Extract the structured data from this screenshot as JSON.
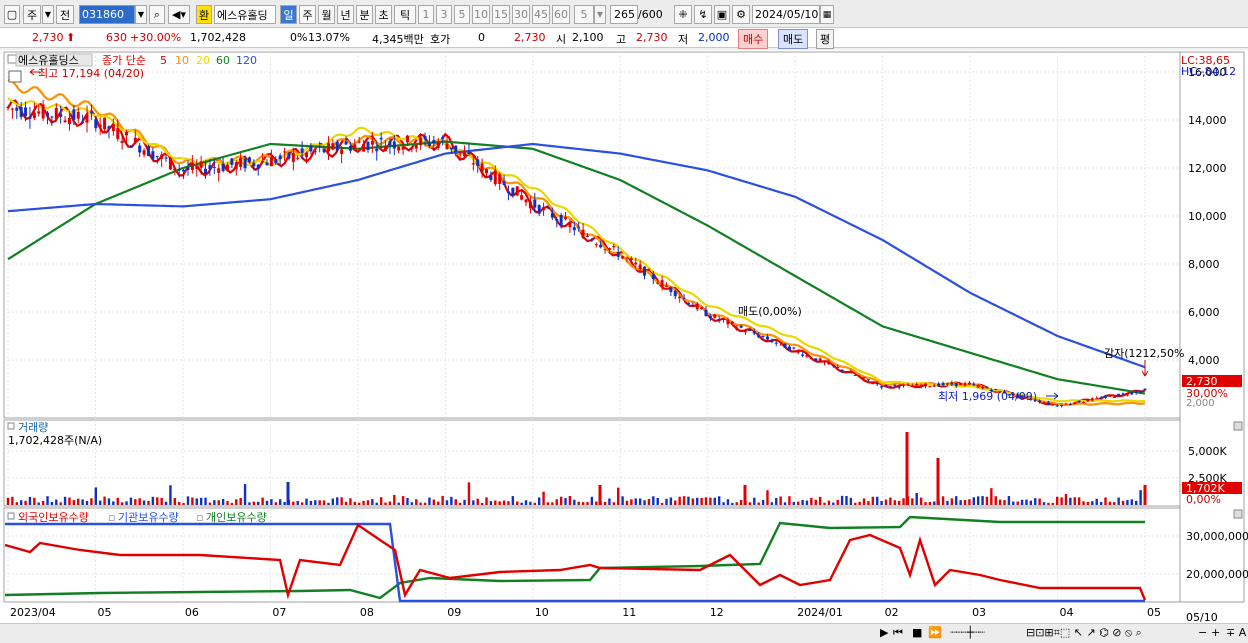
{
  "toolbar": {
    "market": "주",
    "prev": "전",
    "code": "031860",
    "exch_badge": "환",
    "name": "에스유홀딩",
    "periods": [
      "일",
      "주",
      "월",
      "년",
      "분",
      "초",
      "틱"
    ],
    "nums": [
      "1",
      "3",
      "5",
      "10",
      "15",
      "30",
      "45",
      "60"
    ],
    "sel_num": "5",
    "count": "265",
    "count_total": "/600",
    "date": "2024/05/10"
  },
  "quote": {
    "price": "2,730",
    "change": "630",
    "change_pct": "+30.00%",
    "volume": "1,702,428",
    "turnover_a": "0%",
    "turnover_b": "13.07%",
    "amount": "4,345백만",
    "hoga_label": "호가",
    "hoga_value": "0",
    "hoga_price": "2,730",
    "open_label": "시",
    "open": "2,100",
    "high_label": "고",
    "high": "2,730",
    "low_label": "저",
    "low": "2,000",
    "buy": "매수",
    "sell": "매도",
    "eval": "평"
  },
  "price_panel": {
    "title": "에스유홀딩스",
    "legend_prefix": "종가 단순",
    "ma": [
      {
        "label": "5",
        "color": "#e00000"
      },
      {
        "label": "10",
        "color": "#ff9000"
      },
      {
        "label": "20",
        "color": "#e8d800"
      },
      {
        "label": "60",
        "color": "#108020"
      },
      {
        "label": "120",
        "color": "#2a50e0"
      }
    ],
    "high_note": "최고 17,194 (04/20)",
    "low_note": "최저 1,969 (04/09)",
    "mid_note": "매도(0,00%)",
    "vi_note": "감자(1212,50%",
    "lc": "LC:38,65",
    "hc": "HC:-84,12",
    "axis": [
      "16,000",
      "14,000",
      "12,000",
      "10,000",
      "8,000",
      "6,000",
      "4,000"
    ],
    "tag_price": "2,730",
    "tag_pct": "30,00%",
    "tail": "2,000"
  },
  "volume_panel": {
    "title": "거래량",
    "value": "1,702,428주(N/A)",
    "axis": [
      "5,000K",
      "2,500K"
    ],
    "tag": "1,702K",
    "tag_pct": "0,00%"
  },
  "holding_panel": {
    "legends": [
      {
        "label": "외국인보유수량",
        "color": "#e00000"
      },
      {
        "label": "기관보유수량",
        "color": "#2a50e0"
      },
      {
        "label": "개인보유수량",
        "color": "#108020"
      }
    ],
    "axis": [
      "30,000,000",
      "20,000,000"
    ]
  },
  "x_axis": [
    "2023/04",
    "05",
    "06",
    "07",
    "08",
    "09",
    "10",
    "11",
    "12",
    "2024/01",
    "02",
    "03",
    "04",
    "05"
  ],
  "x_end": "05/10",
  "chart_data": {
    "type": "line",
    "title": "에스유홀딩스",
    "x": [
      "2023/04",
      "05",
      "06",
      "07",
      "08",
      "09",
      "10",
      "11",
      "12",
      "2024/01",
      "02",
      "03",
      "04",
      "05"
    ],
    "series": [
      {
        "name": "5",
        "values": [
          14500,
          14000,
          11900,
          12300,
          13000,
          13100,
          10500,
          8400,
          5900,
          4400,
          2900,
          3000,
          2100,
          2730
        ]
      },
      {
        "name": "10",
        "values": [
          15500,
          14500,
          12200,
          12400,
          13200,
          13000,
          10900,
          8300,
          6000,
          4600,
          3000,
          3000,
          2150,
          2200
        ]
      },
      {
        "name": "20",
        "values": [
          14800,
          14300,
          12300,
          12200,
          13600,
          13000,
          11200,
          8600,
          6300,
          4900,
          3100,
          2900,
          2300,
          2300
        ]
      },
      {
        "name": "60",
        "values": [
          8200,
          10500,
          12000,
          13000,
          12800,
          13100,
          12800,
          11500,
          9600,
          7500,
          5400,
          4300,
          3200,
          2600
        ]
      },
      {
        "name": "120",
        "values": [
          10200,
          10500,
          10400,
          10700,
          11500,
          12600,
          13000,
          12600,
          11900,
          10800,
          9000,
          6800,
          5000,
          3700
        ]
      }
    ],
    "ylim": [
      2000,
      17000
    ]
  }
}
